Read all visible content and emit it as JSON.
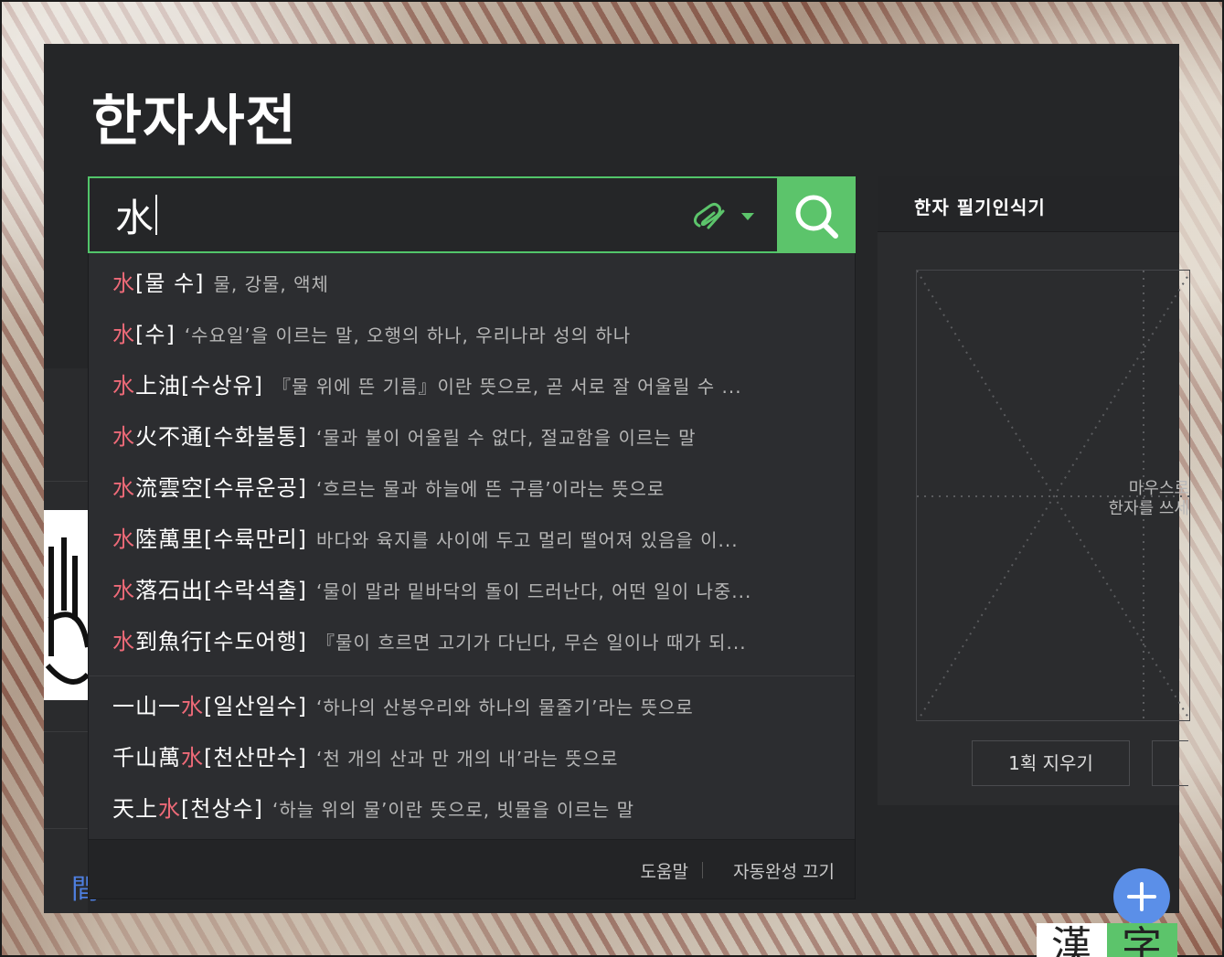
{
  "header": {
    "title": "한자사전"
  },
  "search": {
    "value": "水",
    "tool_icon": "handwriting-pen-icon",
    "search_icon": "search-icon",
    "accent": "#5cc46b"
  },
  "suggestions": [
    {
      "pre": "",
      "hl": "水",
      "post": "",
      "reading": "[물 수]",
      "meaning": "물, 강물, 액체"
    },
    {
      "pre": "",
      "hl": "水",
      "post": "",
      "reading": "[수]",
      "meaning": "‘수요일’을 이르는 말, 오행의 하나, 우리나라 성의 하나"
    },
    {
      "pre": "",
      "hl": "水",
      "post": "上油",
      "reading": "[수상유]",
      "meaning": "『물 위에 뜬 기름』이란 뜻으로, 곧 서로 잘 어울릴 수 ..."
    },
    {
      "pre": "",
      "hl": "水",
      "post": "火不通",
      "reading": "[수화불통]",
      "meaning": "‘물과 불이 어울릴 수 없다, 절교함을 이르는 말"
    },
    {
      "pre": "",
      "hl": "水",
      "post": "流雲空",
      "reading": "[수류운공]",
      "meaning": "‘흐르는 물과 하늘에 뜬 구름’이라는 뜻으로"
    },
    {
      "pre": "",
      "hl": "水",
      "post": "陸萬里",
      "reading": "[수륙만리]",
      "meaning": "바다와 육지를 사이에 두고 멀리 떨어져 있음을 이..."
    },
    {
      "pre": "",
      "hl": "水",
      "post": "落石出",
      "reading": "[수락석출]",
      "meaning": "‘물이 말라 밑바닥의 돌이 드러난다, 어떤 일이 나중..."
    },
    {
      "pre": "",
      "hl": "水",
      "post": "到魚行",
      "reading": "[수도어행]",
      "meaning": "『물이 흐르면 고기가 다닌다, 무슨 일이나 때가 되..."
    },
    {
      "pre": "一山一",
      "hl": "水",
      "post": "",
      "reading": "[일산일수]",
      "meaning": "‘하나의 산봉우리와 하나의 물줄기’라는 뜻으로"
    },
    {
      "pre": "千山萬",
      "hl": "水",
      "post": "",
      "reading": "[천산만수]",
      "meaning": "‘천 개의 산과 만 개의 내’라는 뜻으로"
    },
    {
      "pre": "天上",
      "hl": "水",
      "post": "",
      "reading": "[천상수]",
      "meaning": "‘하늘 위의 물’이란 뜻으로, 빗물을 이르는 말"
    }
  ],
  "dropdown_footer": {
    "help": "도움말",
    "autocomplete_off": "자동완성 끄기"
  },
  "handwriting": {
    "title": "한자 필기인식기",
    "hint_line1": "마우스로",
    "hint_line2": "한자를 쓰세",
    "erase_label": "1획 지우기"
  },
  "background_fragments": {
    "blue_text": "間"
  },
  "corner": {
    "plus_icon": "plus-icon",
    "logo_text": "漢字"
  },
  "colors": {
    "panel": "#252628",
    "highlight": "#ee6a78",
    "plus": "#5b8fe8"
  }
}
